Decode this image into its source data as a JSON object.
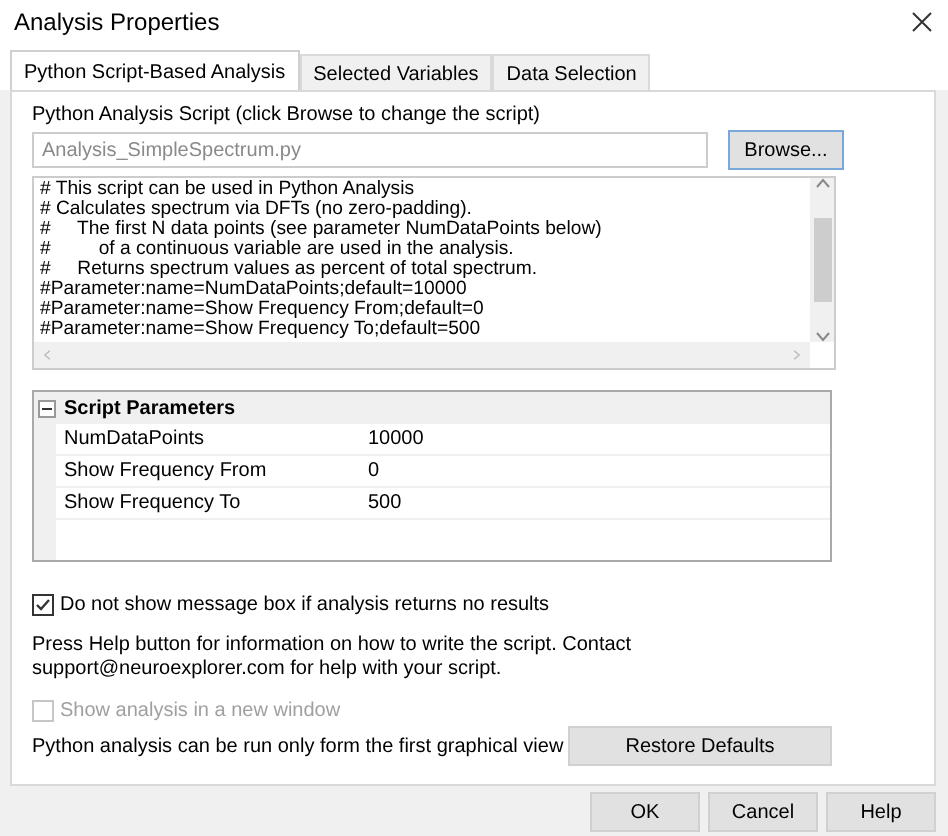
{
  "window": {
    "title": "Analysis Properties"
  },
  "tabs": [
    {
      "label": "Python Script-Based Analysis",
      "selected": true
    },
    {
      "label": "Selected Variables",
      "selected": false
    },
    {
      "label": "Data Selection",
      "selected": false
    }
  ],
  "script": {
    "label": "Python Analysis Script (click Browse to change the script)",
    "file": "Analysis_SimpleSpectrum.py",
    "browse_button": "Browse...",
    "lines": [
      "# This script can be used in Python Analysis",
      "# Calculates spectrum via DFTs (no zero-padding).",
      "#     The first N data points (see parameter NumDataPoints below)",
      "#         of a continuous variable are used in the analysis.",
      "#     Returns spectrum values as percent of total spectrum.",
      "#Parameter:name=NumDataPoints;default=10000",
      "#Parameter:name=Show Frequency From;default=0",
      "#Parameter:name=Show Frequency To;default=500"
    ]
  },
  "parameters": {
    "title": "Script Parameters",
    "expanded": true,
    "rows": [
      {
        "name": "NumDataPoints",
        "value": "10000"
      },
      {
        "name": "Show Frequency From",
        "value": "0"
      },
      {
        "name": "Show Frequency To",
        "value": "500"
      }
    ]
  },
  "no_message_box": {
    "label": "Do not show message box if analysis returns no results",
    "checked": true,
    "disabled": false
  },
  "help_text": "Press Help button for information on how to write the script. Contact support@neuroexplorer.com for help with your script.",
  "new_window": {
    "label": "Show analysis in a new window",
    "checked": false,
    "disabled": true
  },
  "note": "Python analysis can be run only form the first graphical view",
  "restore_button": "Restore Defaults",
  "buttons": [
    "OK",
    "Cancel",
    "Help"
  ]
}
